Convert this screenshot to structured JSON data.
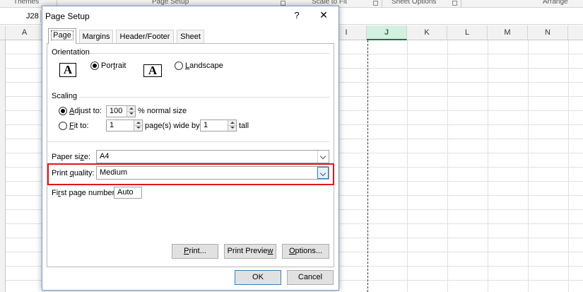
{
  "ribbon": {
    "groups": [
      "Themes",
      "Page Setup",
      "Scale to Fit",
      "Sheet Options",
      "Arrange"
    ]
  },
  "formula_bar": {
    "name_box": "J28"
  },
  "columns": [
    "A",
    "I",
    "J",
    "K",
    "L",
    "M",
    "N"
  ],
  "selected_column": "J",
  "dialog": {
    "title": "Page Setup",
    "help_glyph": "?",
    "close_glyph": "✕",
    "tabs": [
      "Page",
      "Margins",
      "Header/Footer",
      "Sheet"
    ],
    "active_tab": "Page",
    "orientation": {
      "label": "Orientation",
      "icon_glyph": "A",
      "portrait": {
        "pre": "Por",
        "key": "t",
        "post": "rait",
        "checked": true
      },
      "landscape": {
        "pre": "",
        "key": "L",
        "post": "andscape",
        "checked": false
      }
    },
    "scaling": {
      "label": "Scaling",
      "adjust_to": {
        "pre": "",
        "key": "A",
        "post": "djust to:",
        "value": "100",
        "suffix": "% normal size",
        "checked": true
      },
      "fit_to": {
        "pre": "",
        "key": "F",
        "post": "it to:",
        "wide_value": "1",
        "wide_suffix": "page(s) wide by",
        "tall_value": "1",
        "tall_suffix": "tall",
        "checked": false
      }
    },
    "paper_size": {
      "pre": "Paper si",
      "key": "z",
      "post": "e:",
      "value": "A4"
    },
    "print_quality": {
      "pre": "Print ",
      "key": "q",
      "post": "uality:",
      "value": "Medium"
    },
    "first_page_number": {
      "pre": "Fi",
      "key": "r",
      "post": "st page number:",
      "value": "Auto"
    },
    "buttons": {
      "print": {
        "pre": "",
        "key": "P",
        "post": "rint..."
      },
      "print_preview": {
        "pre": "Print Previe",
        "key": "w",
        "post": ""
      },
      "options": {
        "pre": "",
        "key": "O",
        "post": "ptions..."
      },
      "ok": "OK",
      "cancel": "Cancel"
    }
  },
  "colors": {
    "highlight": "#e0161c",
    "selected_column": "#217346",
    "focus": "#3c7fb1"
  }
}
